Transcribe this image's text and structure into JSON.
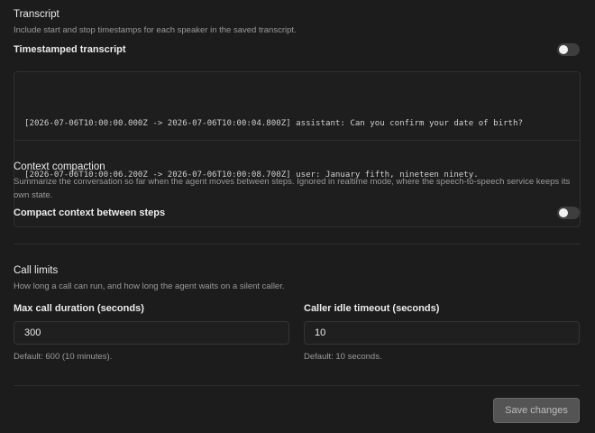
{
  "transcript": {
    "title": "Transcript",
    "description": "Include start and stop timestamps for each speaker in the saved transcript.",
    "toggle_label": "Timestamped transcript",
    "toggle_on": false,
    "lines": [
      "[2026-07-06T10:00:00.000Z -> 2026-07-06T10:00:04.800Z] assistant: Can you confirm your date of birth?",
      "[2026-07-06T10:00:06.200Z -> 2026-07-06T10:00:08.700Z] user: January fifth, nineteen ninety."
    ]
  },
  "compaction": {
    "title": "Context compaction",
    "description": "Summarize the conversation so far when the agent moves between steps. Ignored in realtime mode, where the speech-to-speech service keeps its own state.",
    "toggle_label": "Compact context between steps",
    "toggle_on": false
  },
  "call_limits": {
    "title": "Call limits",
    "description": "How long a call can run, and how long the agent waits on a silent caller.",
    "max_duration": {
      "label": "Max call duration (seconds)",
      "value": "300",
      "hint": "Default: 600 (10 minutes)."
    },
    "idle_timeout": {
      "label": "Caller idle timeout (seconds)",
      "value": "10",
      "hint": "Default: 10 seconds."
    }
  },
  "footer": {
    "save_label": "Save changes"
  }
}
